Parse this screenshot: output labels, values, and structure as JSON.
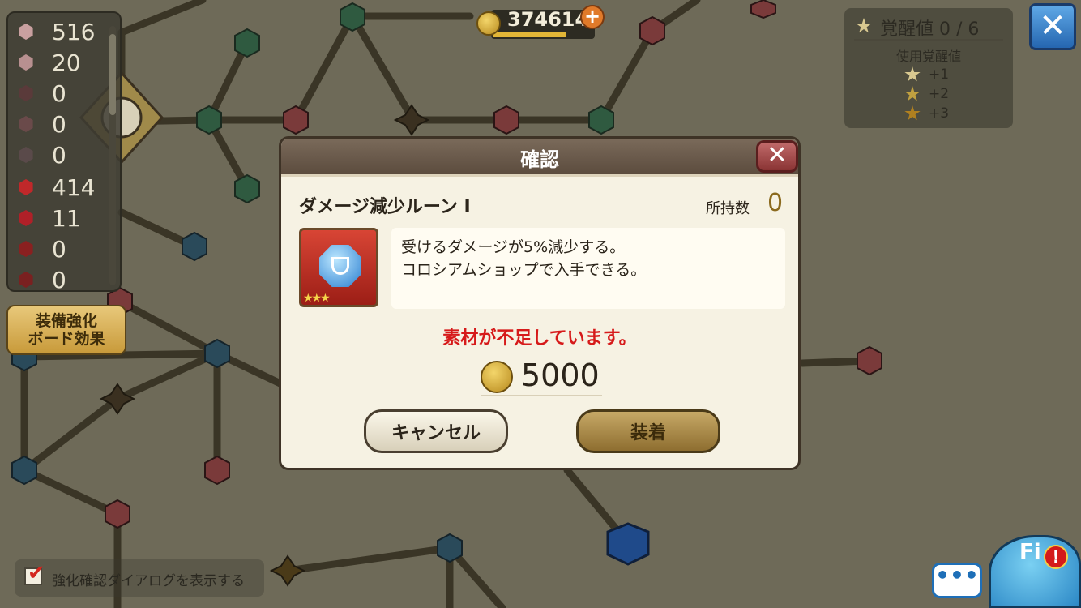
{
  "colors": {
    "accent_red": "#d61a1a",
    "gold": "#8b6a1e",
    "close_blue": "#2566b0"
  },
  "materials": [
    {
      "count": "516",
      "color": "#c9a0a0"
    },
    {
      "count": "20",
      "color": "#b89090"
    },
    {
      "count": "0",
      "color": "#5a3a3a"
    },
    {
      "count": "0",
      "color": "#6a4a4a"
    },
    {
      "count": "0",
      "color": "#5a4a4a"
    },
    {
      "count": "414",
      "color": "#c0282a"
    },
    {
      "count": "11",
      "color": "#b02028"
    },
    {
      "count": "0",
      "color": "#8a2020"
    },
    {
      "count": "0",
      "color": "#7a2020"
    }
  ],
  "board_effect_label": "装備強化\nボード効果",
  "coins": {
    "value": "374614",
    "icon": "coin-icon",
    "add_icon": "plus-icon"
  },
  "awakening": {
    "title": "覚醒値 0 / 6",
    "subtitle": "使用覚醒値",
    "rows": [
      "+1",
      "+2",
      "+3"
    ]
  },
  "dialog": {
    "title": "確認",
    "close_icon": "close-icon",
    "item_name": "ダメージ減少ルーン I",
    "owned_label": "所持数",
    "owned_value": "0",
    "stars": "★★★",
    "description_line1": "受けるダメージが5%減少する。",
    "description_line2": "コロシアムショップで入手できる。",
    "warning": "素材が不足しています。",
    "cost": "5000",
    "cancel_label": "キャンセル",
    "equip_label": "装着"
  },
  "footer": {
    "confirm_dialog_label": "強化確認ダイアログを表示する",
    "chat_label": "•••",
    "mascot_text": "Fi",
    "alert_label": "!"
  }
}
